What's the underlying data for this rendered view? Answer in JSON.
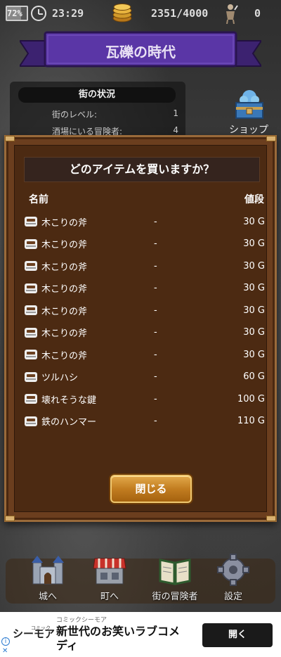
{
  "status_bar": {
    "battery": "72%",
    "time": "23:29",
    "gold": "2351/4000",
    "adventurers": "0"
  },
  "banner": {
    "title": "瓦礫の時代"
  },
  "town": {
    "header": "街の状況",
    "rows": [
      {
        "label": "街のレベル:",
        "value": "1"
      },
      {
        "label": "酒場にいる冒険者:",
        "value": "4"
      }
    ]
  },
  "shop": {
    "label": "ショップ"
  },
  "modal": {
    "title": "どのアイテムを買いますか？",
    "col_name": "名前",
    "col_price": "値段",
    "items": [
      {
        "name": "木こりの斧",
        "mid": "-",
        "price": "30 G"
      },
      {
        "name": "木こりの斧",
        "mid": "-",
        "price": "30 G"
      },
      {
        "name": "木こりの斧",
        "mid": "-",
        "price": "30 G"
      },
      {
        "name": "木こりの斧",
        "mid": "-",
        "price": "30 G"
      },
      {
        "name": "木こりの斧",
        "mid": "-",
        "price": "30 G"
      },
      {
        "name": "木こりの斧",
        "mid": "-",
        "price": "30 G"
      },
      {
        "name": "木こりの斧",
        "mid": "-",
        "price": "30 G"
      },
      {
        "name": "ツルハシ",
        "mid": "-",
        "price": "60 G"
      },
      {
        "name": "壊れそうな鍵",
        "mid": "-",
        "price": "100 G"
      },
      {
        "name": "鉄のハンマー",
        "mid": "-",
        "price": "110 G"
      }
    ],
    "close_label": "閉じる"
  },
  "bottom_nav": {
    "castle": "城へ",
    "town": "町へ",
    "adventurers": "街の冒険者",
    "settings": "設定"
  },
  "ad": {
    "sponsor": "コミックシーモア",
    "logo": "シーモア",
    "logo_sup": "コミック",
    "text": "新世代のお笑いラブコメディ",
    "button": "開く"
  },
  "colors": {
    "banner_purple": "#4a2a8a",
    "modal_brown": "#4c2a12",
    "button_gold": "#c27d20"
  }
}
